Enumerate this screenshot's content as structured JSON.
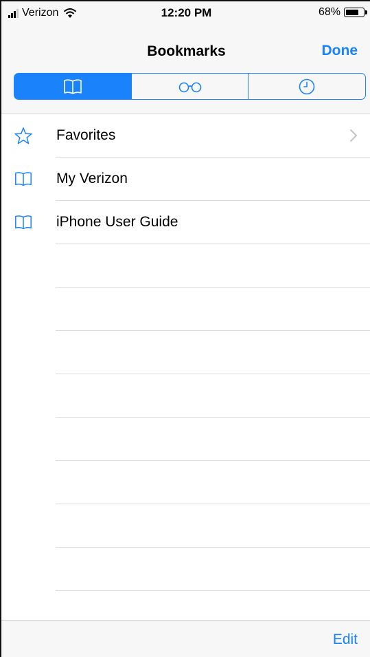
{
  "status_bar": {
    "carrier": "Verizon",
    "time": "12:20 PM",
    "battery": "68%",
    "battery_level": 0.68
  },
  "nav": {
    "title": "Bookmarks",
    "done_label": "Done"
  },
  "segments": [
    {
      "icon": "book-icon",
      "active": true
    },
    {
      "icon": "glasses-icon",
      "active": false
    },
    {
      "icon": "clock-icon",
      "active": false
    }
  ],
  "list": {
    "items": [
      {
        "label": "Favorites",
        "icon": "star-icon",
        "chevron": true
      },
      {
        "label": "My Verizon",
        "icon": "book-icon",
        "chevron": false
      },
      {
        "label": "iPhone User Guide",
        "icon": "book-icon",
        "chevron": false
      }
    ]
  },
  "toolbar": {
    "edit_label": "Edit"
  },
  "colors": {
    "accent": "#1a82fb",
    "bar_background": "#f7f7f7",
    "separator": "#dcdcdc"
  }
}
